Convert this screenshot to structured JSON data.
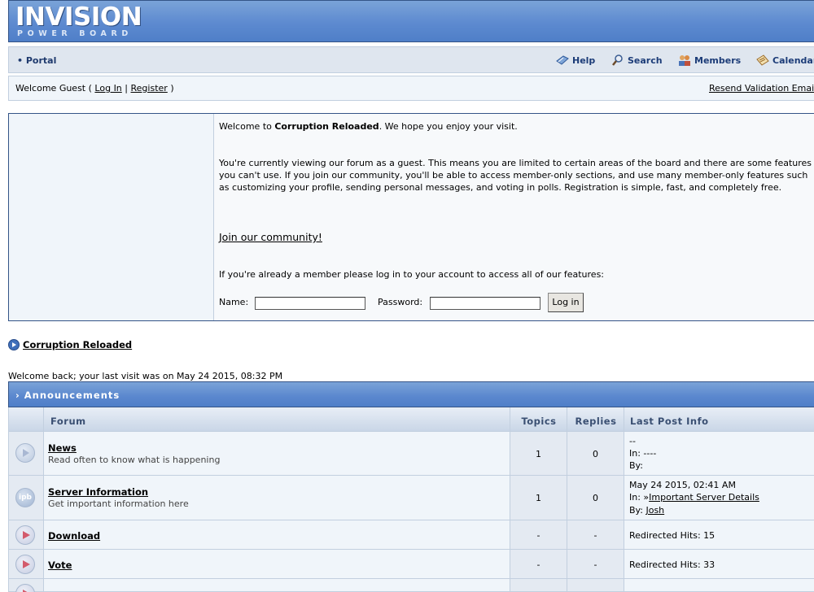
{
  "logo": {
    "main": "INVISION",
    "sub": "POWER BOARD"
  },
  "submenu": {
    "portal": "Portal",
    "links": [
      {
        "label": "Help",
        "icon": "help-icon"
      },
      {
        "label": "Search",
        "icon": "search-icon"
      },
      {
        "label": "Members",
        "icon": "members-icon"
      },
      {
        "label": "Calendar",
        "icon": "calendar-icon"
      }
    ]
  },
  "userbar": {
    "welcome_prefix": "Welcome Guest (",
    "login": "Log In",
    "sep": "|",
    "register": "Register",
    "welcome_suffix": ")",
    "resend": "Resend Validation Email"
  },
  "guest": {
    "welcome_prefix": "Welcome to ",
    "board_name": "Corruption Reloaded",
    "welcome_suffix": ". We hope you enjoy your visit.",
    "paragraph": "You're currently viewing our forum as a guest. This means you are limited to certain areas of the board and there are some features you can't use. If you join our community, you'll be able to access member-only sections, and use many member-only features such as customizing your profile, sending personal messages, and voting in polls. Registration is simple, fast, and completely free.",
    "join": "Join our community!",
    "member_text": "If you're already a member please log in to your account to access all of our features:",
    "name_label": "Name:",
    "password_label": "Password:",
    "login_button": "Log in"
  },
  "crumb": "Corruption Reloaded",
  "last_visit": "Welcome back; your last visit was on May 24 2015, 08:32 PM",
  "category": {
    "title": "Announcements",
    "headers": {
      "forum": "Forum",
      "topics": "Topics",
      "replies": "Replies",
      "last": "Last Post Info"
    },
    "forums": [
      {
        "title": "News",
        "desc": "Read often to know what is happening",
        "topics": "1",
        "replies": "0",
        "last": [
          "--",
          "In: ----",
          "By:"
        ]
      },
      {
        "title": "Server Information",
        "desc": "Get important information here",
        "topics": "1",
        "replies": "0",
        "last_date": "May 24 2015, 02:41 AM",
        "last_in": "In: ",
        "last_topic": "Important Server Details",
        "last_by": "By: ",
        "last_author": "Josh"
      },
      {
        "title": "Download",
        "topics": "-",
        "replies": "-",
        "redirect": "Redirected Hits: 15"
      },
      {
        "title": "Vote",
        "topics": "-",
        "replies": "-",
        "redirect": "Redirected Hits: 33"
      }
    ]
  }
}
